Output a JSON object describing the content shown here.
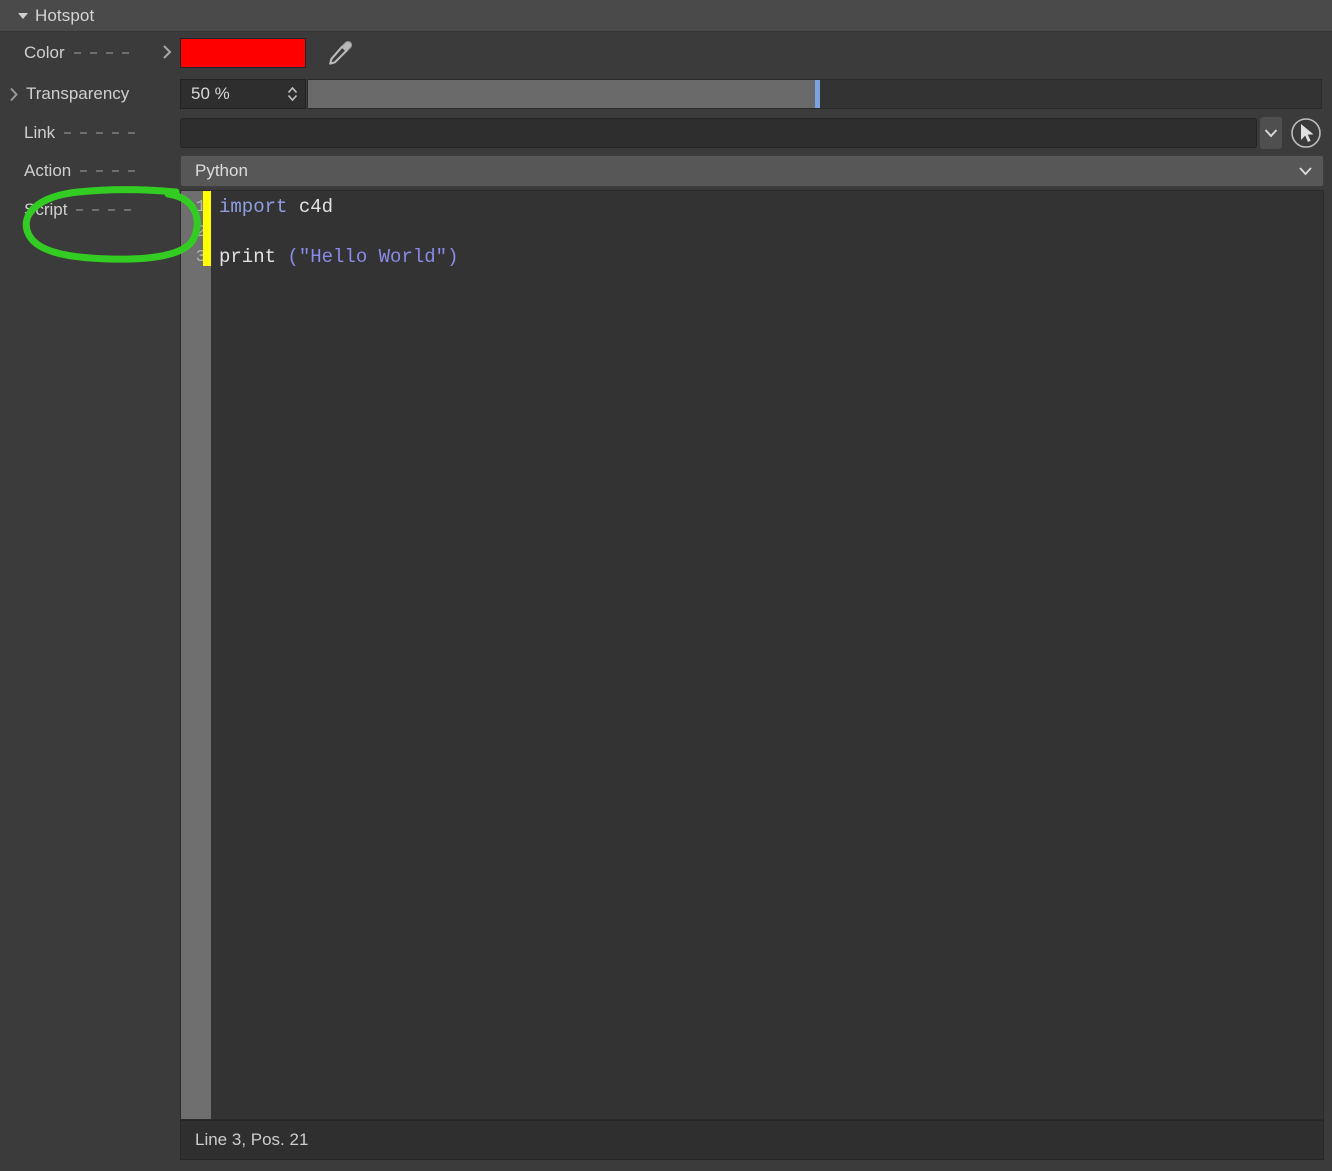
{
  "window": {
    "title": "Hotspot",
    "disclosure_icon": "triangle-down-icon"
  },
  "properties": {
    "color": {
      "label": "Color",
      "leader_dots": 4,
      "expand_icon": "chevron-right-icon",
      "swatch_hex": "#FF0000",
      "picker_icon": "eyedropper-icon"
    },
    "transparency": {
      "label": "Transparency",
      "expand_icon": "chevron-right-icon",
      "value": "50 %",
      "slider_percent": 50,
      "spinner_icon": "spinner-updown-icon",
      "slider_knob_hex": "#7BA3DD"
    },
    "link": {
      "label": "Link",
      "leader_dots": 5,
      "value": "",
      "dropdown_icon": "chevron-down-icon",
      "pick_icon": "pick-object-cursor-icon"
    },
    "action": {
      "label": "Action",
      "leader_dots": 4,
      "value": "Python",
      "dropdown_icon": "chevron-down-icon",
      "options": [
        "Python"
      ]
    },
    "script": {
      "label": "Script",
      "leader_dots": 4
    }
  },
  "editor": {
    "line_numbers": [
      "1",
      "2",
      "3"
    ],
    "modified_marker_hex": "#FFFF00",
    "lines": [
      {
        "tokens": [
          {
            "t": "import",
            "c": "kw"
          },
          {
            "t": " c4d",
            "c": "plain"
          }
        ]
      },
      {
        "tokens": []
      },
      {
        "tokens": [
          {
            "t": "print",
            "c": "plain"
          },
          {
            "t": " (",
            "c": "punc"
          },
          {
            "t": "\"Hello World\"",
            "c": "str"
          },
          {
            "t": ")",
            "c": "punc"
          }
        ]
      }
    ]
  },
  "statusbar": {
    "text": "Line 3, Pos. 21"
  },
  "annotation": {
    "shape": "ellipse-highlight",
    "color": "#33CC22",
    "target": "Script"
  }
}
